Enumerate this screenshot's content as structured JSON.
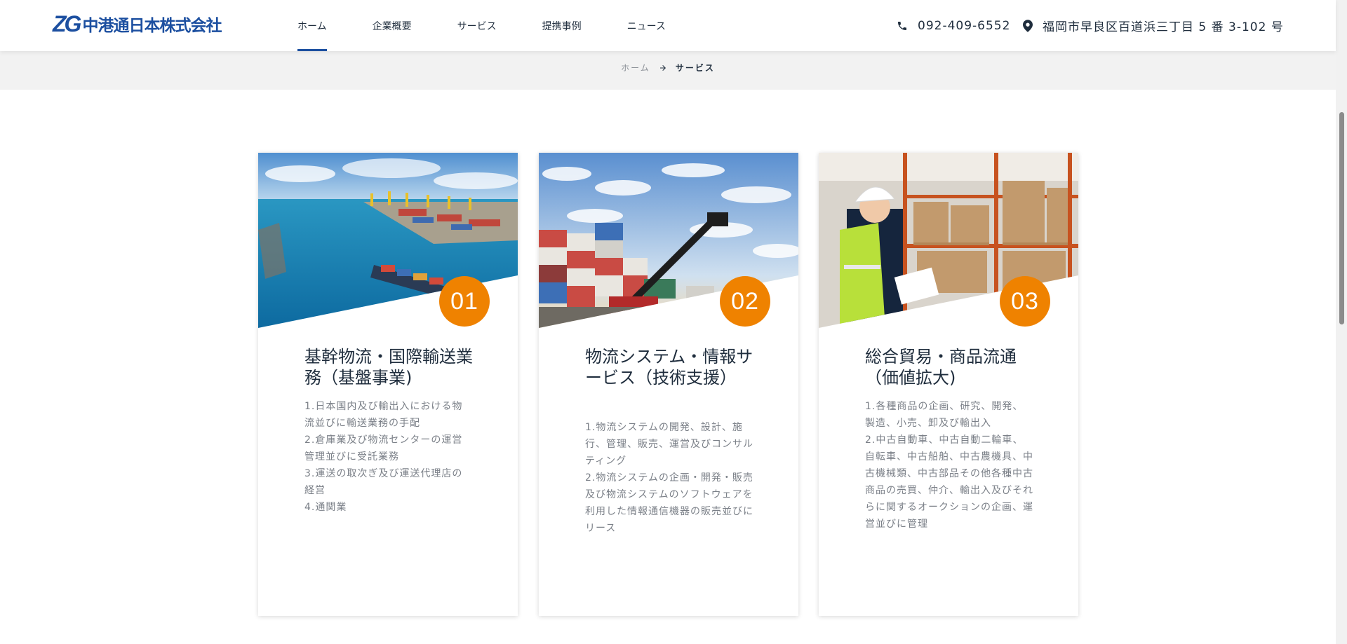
{
  "header": {
    "logo_mark": "ZG",
    "logo_text": "中港通日本株式会社",
    "nav": [
      {
        "label": "ホーム",
        "active": true
      },
      {
        "label": "企業概要",
        "active": false
      },
      {
        "label": "サービス",
        "active": false
      },
      {
        "label": "提携事例",
        "active": false
      },
      {
        "label": "ニュース",
        "active": false
      }
    ],
    "phone": "092-409-6552",
    "address": "福岡市早良区百道浜三丁目 5 番 3-102 号"
  },
  "breadcrumb": {
    "home": "ホーム",
    "current": "サービス"
  },
  "services": [
    {
      "number": "01",
      "title": "基幹物流・国際輸送業務（基盤事業)",
      "items": [
        "1.日本国内及び輸出入における物流並びに輸送業務の手配",
        "2.倉庫業及び物流センターの運営管理並びに受託業務",
        "3.運送の取次ぎ及び運送代理店の経営",
        "4.通関業"
      ]
    },
    {
      "number": "02",
      "title": "物流システム・情報サービス（技術支援）",
      "items": [
        "1.物流システムの開発、設計、施行、管理、販売、運営及びコンサルティング",
        "2.物流システムの企画・開発・販売及び物流システムのソフトウェアを利用した情報通信機器の販売並びにリース"
      ]
    },
    {
      "number": "03",
      "title": "総合貿易・商品流通（価値拡大)",
      "items": [
        "1.各種商品の企画、研究、開発、製造、小売、卸及び輸出入",
        "2.中古自動車、中古自動二輪車、自転車、中古船舶、中古農機具、中古機械類、中古部品その他各種中古商品の売買、仲介、輸出入及びそれらに関するオークションの企画、運営並びに管理"
      ]
    }
  ],
  "icons": {
    "phone": "phone-icon",
    "address": "location-pin-icon",
    "breadcrumb_separator": "arrow-right-icon"
  },
  "colors": {
    "brand": "#1c4fa0",
    "accent": "#ef8200",
    "text": "#1f2d3d",
    "muted": "#7b8088",
    "band": "#f2f2f2"
  }
}
